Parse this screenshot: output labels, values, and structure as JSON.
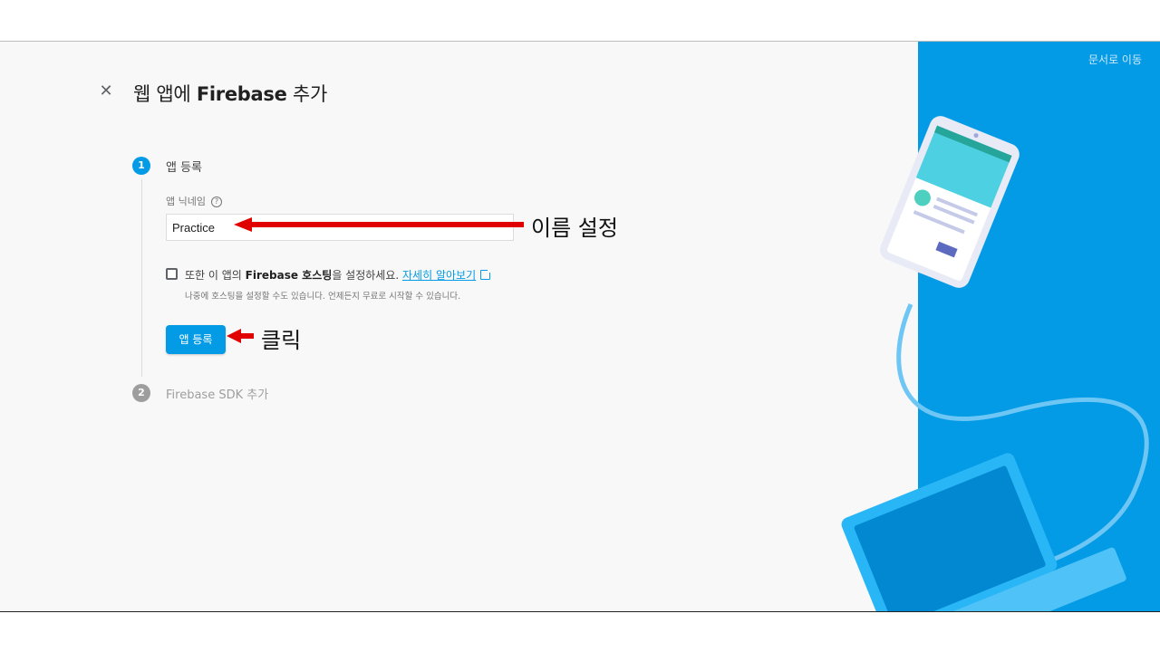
{
  "header": {
    "title_prefix": "웹 앱에",
    "title_brand": "Firebase",
    "title_suffix": "추가",
    "docs_link": "문서로 이동",
    "close_icon": "close-icon"
  },
  "steps": [
    {
      "number": "1",
      "label": "앱 등록",
      "active": true
    },
    {
      "number": "2",
      "label": "Firebase SDK 추가",
      "active": false
    }
  ],
  "form": {
    "nickname_label": "앱 닉네임",
    "help_icon": "?",
    "nickname_value": "Practice",
    "hosting_prefix": "또한 이 앱의",
    "hosting_bold": "Firebase 호스팅",
    "hosting_suffix": "을 설정하세요.",
    "learn_more": "자세히 알아보기",
    "hosting_note": "나중에 호스팅을 설정할 수도 있습니다. 언제든지 무료로 시작할 수 있습니다.",
    "hosting_checked": false,
    "register_button": "앱 등록"
  },
  "annotations": {
    "name_hint": "이름 설정",
    "click_hint": "클릭",
    "arrow_color": "#e00000"
  },
  "colors": {
    "accent": "#039be5",
    "panel": "#039be5",
    "background": "#f8f8f8"
  }
}
